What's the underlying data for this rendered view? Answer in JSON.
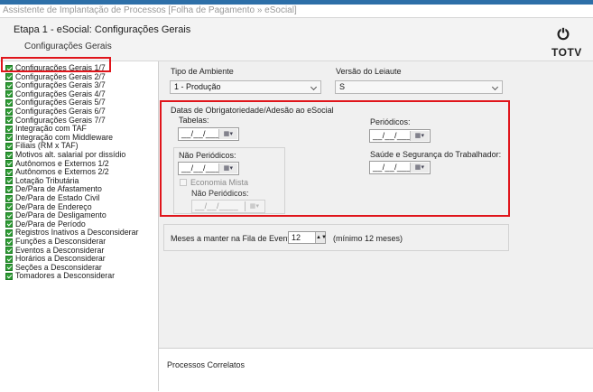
{
  "window": {
    "title": "Assistente de Implantação de Processos [Folha de Pagamento » eSocial]"
  },
  "header": {
    "stage_title": "Etapa 1 - eSocial: Configurações Gerais",
    "stage_subtitle": "Configurações Gerais",
    "logo_text": "TOTV",
    "logo_icon": "power-icon"
  },
  "tree": {
    "items": [
      "Configurações Gerais 1/7",
      "Configurações Gerais 2/7",
      "Configurações Gerais 3/7",
      "Configurações Gerais 4/7",
      "Configurações Gerais 5/7",
      "Configurações Gerais 6/7",
      "Configurações Gerais 7/7",
      "Integração com TAF",
      "Integração com Middleware",
      "Filiais (RM x TAF)",
      "Motivos alt. salarial por dissídio",
      "Autônomos e Externos 1/2",
      "Autônomos e Externos 2/2",
      "Lotação Tributária",
      "De/Para de Afastamento",
      "De/Para de Estado Civil",
      "De/Para de Endereço",
      "De/Para de Desligamento",
      "De/Para de Período",
      "Registros Inativos a Desconsiderar",
      "Funções a Desconsiderar",
      "Eventos a Desconsiderar",
      "Horários a Desconsiderar",
      "Seções a Desconsiderar",
      "Tomadores a Desconsiderar"
    ],
    "item_icon": "check-icon"
  },
  "form": {
    "tipo_ambiente": {
      "label": "Tipo de Ambiente",
      "value": "1 - Produção"
    },
    "versao_leiaute": {
      "label": "Versão do Leiaute",
      "value": "S"
    },
    "datas": {
      "group_label": "Datas de Obrigatoriedade/Adesão ao eSocial",
      "tabelas": {
        "label": "Tabelas:",
        "value": "__/__/____"
      },
      "periodicos": {
        "label": "Periódicos:",
        "value": "__/__/____"
      },
      "nao_periodicos": {
        "label": "Não Periódicos:",
        "value": "__/__/____"
      },
      "economia_mista": {
        "label": "Economia Mista"
      },
      "nao_periodicos_mista": {
        "label": "Não Periódicos:",
        "value": "__/__/____"
      },
      "saude_seguranca": {
        "label": "Saúde e Segurança do Trabalhador:",
        "value": "__/__/____"
      }
    },
    "meses": {
      "label": "Meses a manter na Fila de Eventos:",
      "value": "12",
      "hint": "(mínimo 12 meses)"
    }
  },
  "correlatos": {
    "label": "Processos Correlatos"
  },
  "colors": {
    "highlight_red": "#e0151b",
    "check_green": "#2f9e35",
    "top_strip": "#2d6fa8"
  }
}
